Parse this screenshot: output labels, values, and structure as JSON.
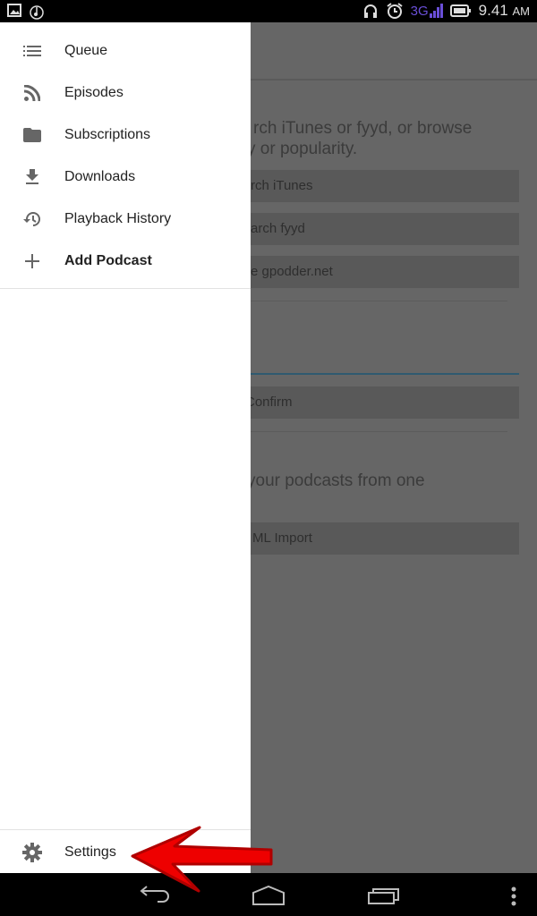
{
  "status_bar": {
    "left_icons": [
      "image-icon",
      "music-sync-icon"
    ],
    "right_icons": [
      "headset-icon",
      "alarm-icon",
      "signal-3g-icon",
      "battery-icon"
    ],
    "network": "3G",
    "time": "9.41",
    "ampm": "AM"
  },
  "background": {
    "intro_line1": "rch iTunes or fyyd, or browse",
    "intro_line2": "y or popularity.",
    "buttons": [
      "rch iTunes",
      "arch fyyd",
      "e gpodder.net"
    ],
    "confirm": "Confirm",
    "opml_text": "your podcasts from one",
    "opml_button": "ML Import"
  },
  "drawer": {
    "items": [
      {
        "label": "Queue",
        "icon": "queue-list-icon"
      },
      {
        "label": "Episodes",
        "icon": "rss-icon"
      },
      {
        "label": "Subscriptions",
        "icon": "folder-icon"
      },
      {
        "label": "Downloads",
        "icon": "download-icon"
      },
      {
        "label": "Playback History",
        "icon": "history-icon"
      },
      {
        "label": "Add Podcast",
        "icon": "plus-icon"
      }
    ],
    "settings": {
      "label": "Settings",
      "icon": "gear-icon"
    }
  },
  "annotation": {
    "arrow_color": "#ee0000"
  },
  "nav_bar": {
    "buttons": [
      "back",
      "home",
      "recents",
      "menu"
    ]
  }
}
